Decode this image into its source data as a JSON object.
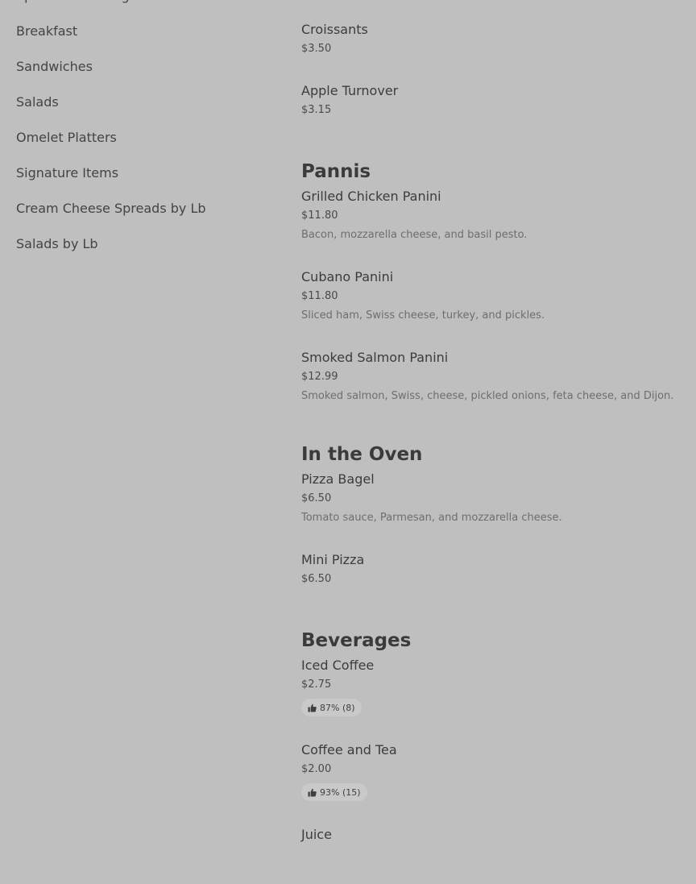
{
  "sidebar": {
    "items": [
      {
        "label": "Spreads on a Bagel"
      },
      {
        "label": "Breakfast"
      },
      {
        "label": "Sandwiches"
      },
      {
        "label": "Salads"
      },
      {
        "label": "Omelet Platters"
      },
      {
        "label": "Signature Items"
      },
      {
        "label": "Cream Cheese Spreads by Lb"
      },
      {
        "label": "Salads by Lb"
      }
    ]
  },
  "menu": {
    "bakery_items": [
      {
        "name": "Croissants",
        "price": "$3.50"
      },
      {
        "name": "Apple Turnover",
        "price": "$3.15"
      }
    ],
    "pannis": {
      "title": "Pannis",
      "items": [
        {
          "name": "Grilled Chicken Panini",
          "price": "$11.80",
          "description": "Bacon, mozzarella cheese, and basil pesto."
        },
        {
          "name": "Cubano Panini",
          "price": "$11.80",
          "description": "Sliced ham, Swiss cheese, turkey, and pickles."
        },
        {
          "name": "Smoked Salmon Panini",
          "price": "$12.99",
          "description": "Smoked salmon, Swiss, cheese, pickled onions, feta cheese, and Dijon."
        }
      ]
    },
    "oven": {
      "title": "In the Oven",
      "items": [
        {
          "name": "Pizza Bagel",
          "price": "$6.50",
          "description": "Tomato sauce, Parmesan, and mozzarella cheese."
        },
        {
          "name": "Mini Pizza",
          "price": "$6.50"
        }
      ]
    },
    "beverages": {
      "title": "Beverages",
      "items": [
        {
          "name": "Iced Coffee",
          "price": "$2.75",
          "rating": "87% (8)"
        },
        {
          "name": "Coffee and Tea",
          "price": "$2.00",
          "rating": "93% (15)"
        },
        {
          "name": "Juice"
        }
      ]
    }
  },
  "icons": {
    "thumbs_up": "thumbs-up-icon"
  }
}
